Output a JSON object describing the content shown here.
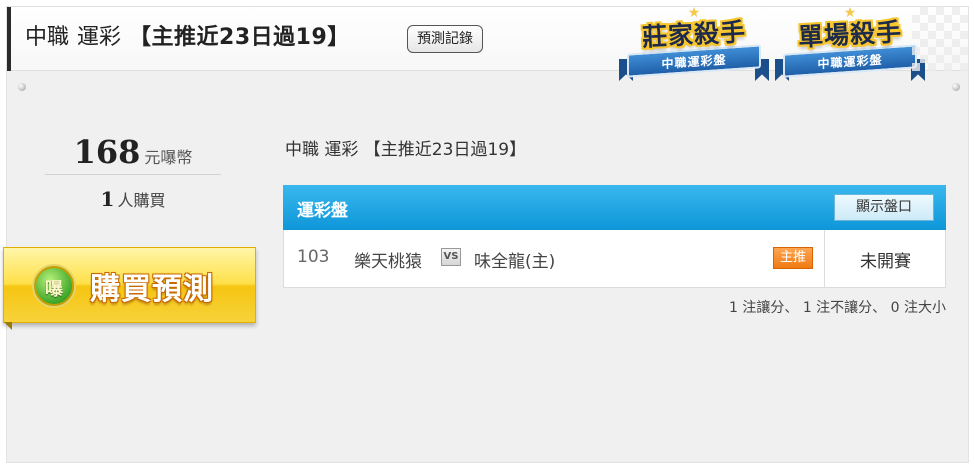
{
  "header": {
    "league": "中職",
    "bet_type": "運彩",
    "tip_label": "【主推近23日過19】",
    "record_button": "預測記錄"
  },
  "badges": [
    {
      "title": "莊家殺手",
      "subtitle": "中職運彩盤"
    },
    {
      "title": "單場殺手",
      "subtitle": "中職運彩盤"
    }
  ],
  "purchase": {
    "price": "168",
    "price_unit": "元嚗幣",
    "buyers": "1",
    "buyers_unit": "人購買",
    "buy_button": "購買預測",
    "icon_glyph": "嚗"
  },
  "prediction": {
    "title": "中職 運彩 【主推近23日過19】",
    "table_title": "運彩盤",
    "show_odds_button": "顯示盤口",
    "game": {
      "number": "103",
      "away_team": "樂天桃猿",
      "vs": "VS",
      "home_team": "味全龍(主)",
      "tag": "主推",
      "status": "未開賽"
    },
    "summary": "1 注讓分、 1 注不讓分、 0 注大小"
  },
  "colors": {
    "table_header": "#1aa5e3",
    "main_tag": "#f07a12",
    "buy_button": "#ffe04a"
  }
}
